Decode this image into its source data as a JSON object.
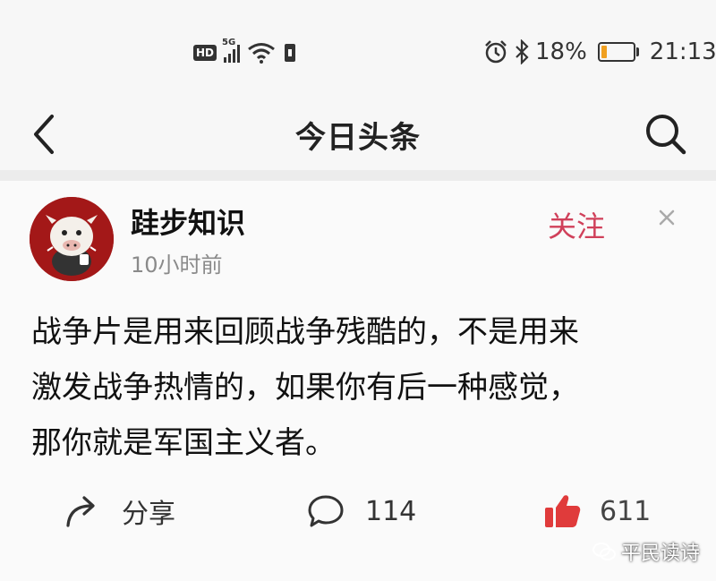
{
  "status_bar": {
    "hd_label": "HD",
    "network": "5G",
    "battery_percent": "18%",
    "battery_level": 0.18,
    "time": "21:13",
    "icons": [
      "hd-icon",
      "signal-icon",
      "wifi-icon",
      "sim-icon",
      "alarm-icon",
      "bluetooth-icon",
      "battery-icon"
    ]
  },
  "header": {
    "title": "今日头条",
    "back_icon": "back-icon",
    "search_icon": "search-icon"
  },
  "post": {
    "author": "跬步知识",
    "time": "10小时前",
    "follow_label": "关注",
    "close_icon": "close-icon",
    "lines": [
      "战争片是用来回顾战争残酷的，不是用来",
      "激发战争热情的，如果你有后一种感觉，",
      "那你就是军国主义者。"
    ]
  },
  "actions": {
    "share_label": "分享",
    "comment_count": "114",
    "like_count": "611"
  },
  "watermark": {
    "text": "平民读诗"
  },
  "colors": {
    "accent": "#d0405a",
    "like": "#e03b3b",
    "avatar_bg": "#a31818"
  }
}
